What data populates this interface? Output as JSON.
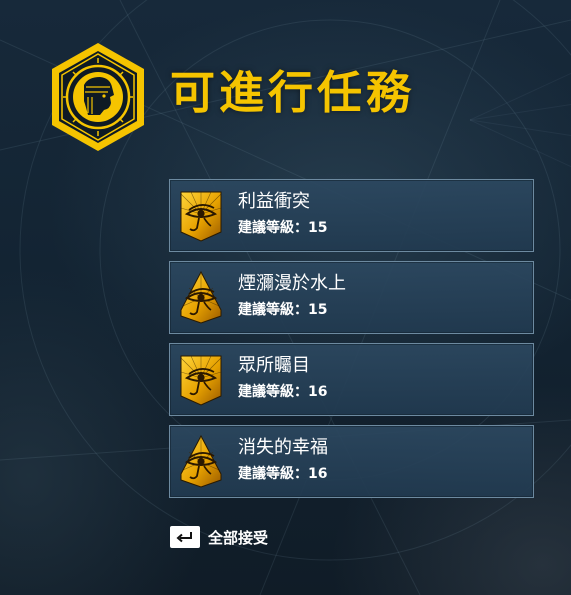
{
  "header": {
    "title": "可進行任務",
    "emblem_icon": "pharaoh-head-emblem-icon"
  },
  "quests": [
    {
      "name": "利益衝突",
      "level_text": "建議等級：15",
      "icon": "eye-of-horus-icon"
    },
    {
      "name": "煙瀰漫於水上",
      "level_text": "建議等級：15",
      "icon": "eye-of-horus-icon"
    },
    {
      "name": "眾所矚目",
      "level_text": "建議等級：16",
      "icon": "eye-of-horus-icon"
    },
    {
      "name": "消失的幸福",
      "level_text": "建議等級：16",
      "icon": "eye-of-horus-icon"
    }
  ],
  "footer": {
    "accept_all_label": "全部接受",
    "accept_key_icon": "enter-key-icon"
  },
  "colors": {
    "title": "#f5c400",
    "card_border": "#6d8aa0",
    "card_bg": "#2c4860",
    "icon_gold": "#e0a400"
  }
}
